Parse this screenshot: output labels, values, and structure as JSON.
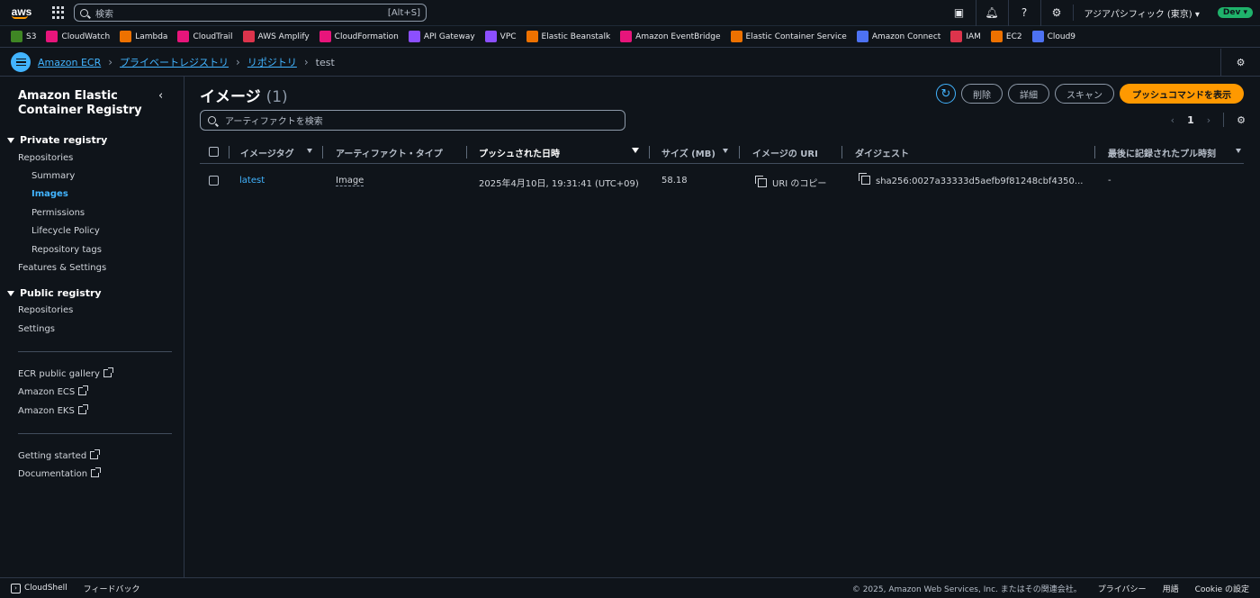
{
  "topbar": {
    "logo": "aws",
    "search_placeholder": "検索",
    "search_hint": "[Alt+S]",
    "region": "アジアパシフィック (東京) ▾",
    "account": "Dev ▾"
  },
  "favorites": [
    {
      "label": "S3",
      "color": "#3f8624"
    },
    {
      "label": "CloudWatch",
      "color": "#e7157b"
    },
    {
      "label": "Lambda",
      "color": "#ed7100"
    },
    {
      "label": "CloudTrail",
      "color": "#e7157b"
    },
    {
      "label": "AWS Amplify",
      "color": "#dd344c"
    },
    {
      "label": "CloudFormation",
      "color": "#e7157b"
    },
    {
      "label": "API Gateway",
      "color": "#8c4fff"
    },
    {
      "label": "VPC",
      "color": "#8c4fff"
    },
    {
      "label": "Elastic Beanstalk",
      "color": "#ed7100"
    },
    {
      "label": "Amazon EventBridge",
      "color": "#e7157b"
    },
    {
      "label": "Elastic Container Service",
      "color": "#ed7100"
    },
    {
      "label": "Amazon Connect",
      "color": "#4d72f3"
    },
    {
      "label": "IAM",
      "color": "#dd344c"
    },
    {
      "label": "EC2",
      "color": "#ed7100"
    },
    {
      "label": "Cloud9",
      "color": "#4d72f3"
    }
  ],
  "breadcrumb": {
    "items": [
      "Amazon ECR",
      "プライベートレジストリ",
      "リポジトリ"
    ],
    "current": "test"
  },
  "sidebar": {
    "title": "Amazon Elastic Container Registry",
    "private_head": "Private registry",
    "private_items": [
      "Repositories",
      "Summary",
      "Images",
      "Permissions",
      "Lifecycle Policy",
      "Repository tags",
      "Features & Settings"
    ],
    "public_head": "Public registry",
    "public_items": [
      "Repositories",
      "Settings"
    ],
    "external1": [
      "ECR public gallery",
      "Amazon ECS",
      "Amazon EKS"
    ],
    "external2": [
      "Getting started",
      "Documentation"
    ]
  },
  "main": {
    "title": "イメージ",
    "count": "(1)",
    "buttons": {
      "delete": "削除",
      "details": "詳細",
      "scan": "スキャン",
      "push": "プッシュコマンドを表示"
    },
    "filter_placeholder": "アーティファクトを検索",
    "page": "1"
  },
  "table": {
    "headers": [
      "イメージタグ",
      "アーティファクト・タイプ",
      "プッシュされた日時",
      "サイズ (MB)",
      "イメージの URI",
      "ダイジェスト",
      "最後に記録されたプル時刻"
    ],
    "rows": [
      {
        "tag": "latest",
        "type": "Image",
        "pushed": "2025年4月10日, 19:31:41 (UTC+09)",
        "size": "58.18",
        "uri": "URI のコピー",
        "digest": "sha256:0027a33333d5aefb9f81248cbf4350...",
        "last_pull": "-"
      }
    ]
  },
  "footer": {
    "cloudshell": "CloudShell",
    "feedback": "フィードバック",
    "copyright": "© 2025, Amazon Web Services, Inc. またはその関連会社。",
    "privacy": "プライバシー",
    "terms": "用語",
    "cookie": "Cookie の設定"
  }
}
